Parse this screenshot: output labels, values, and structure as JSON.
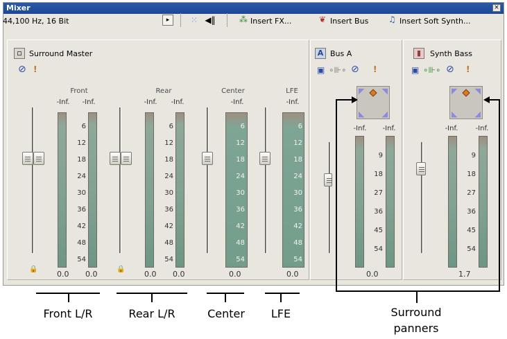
{
  "window": {
    "title": "Mixer",
    "close_glyph": "×"
  },
  "toolbar": {
    "sample_rate": "44,100 Hz, 16 Bit",
    "insert_fx": "Insert FX...",
    "insert_bus": "Insert Bus",
    "insert_soft_synth": "Insert Soft Synth..."
  },
  "surround_master": {
    "title": "Surround Master",
    "channels": {
      "front": "Front",
      "rear": "Rear",
      "center": "Center",
      "lfe": "LFE"
    },
    "peak_top": "-Inf.",
    "peaks": {
      "front_l": "0.0",
      "front_r": "0.0",
      "rear_l": "0.0",
      "rear_r": "0.0",
      "center": "0.0",
      "lfe": "0.0"
    },
    "scale": [
      "6",
      "12",
      "18",
      "24",
      "30",
      "36",
      "42",
      "48",
      "54"
    ]
  },
  "bus_a": {
    "title": "Bus A",
    "icon_letter": "A",
    "peak_top": "-Inf.",
    "peak_bottom": "0.0",
    "scale": [
      "9",
      "18",
      "27",
      "36",
      "45",
      "54"
    ]
  },
  "synth_bass": {
    "title": "Synth Bass",
    "peak_top": "-Inf.",
    "peak_bottom": "1.7",
    "scale": [
      "9",
      "18",
      "27",
      "36",
      "45",
      "54"
    ]
  },
  "annotations": {
    "front": "Front L/R",
    "rear": "Rear L/R",
    "center": "Center",
    "lfe": "LFE",
    "surround_1": "Surround",
    "surround_2": "panners"
  },
  "colors": {
    "title_bar": "#1d4796",
    "meter": "#739d8a",
    "panner_arrows": "#8a8ae0",
    "panner_point": "#e07820"
  }
}
